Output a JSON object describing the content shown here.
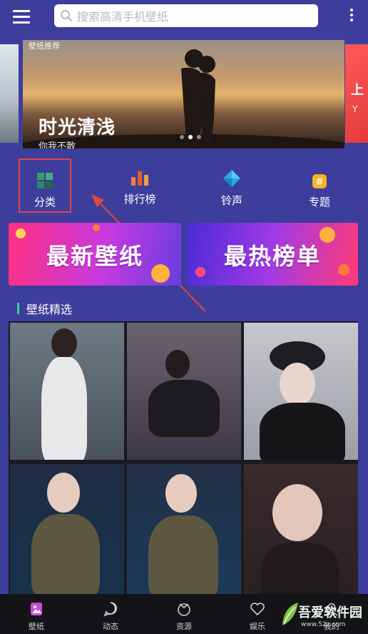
{
  "search": {
    "placeholder": "搜索高清手机壁纸"
  },
  "banner": {
    "tag": "壁纸推荐",
    "title": "时光清浅",
    "subtitle": "你我不散",
    "dots": 3,
    "active_dot": 1
  },
  "quick_links": [
    {
      "label": "分类",
      "icon": "category-grid-icon"
    },
    {
      "label": "排行榜",
      "icon": "ranking-bars-icon"
    },
    {
      "label": "铃声",
      "icon": "ringtone-diamond-icon"
    },
    {
      "label": "专题",
      "icon": "topic-hash-icon"
    }
  ],
  "promos": {
    "new": "最新壁纸",
    "hot": "最热榜单"
  },
  "section": {
    "title": "壁纸精选"
  },
  "tabs": [
    {
      "label": "壁纸",
      "icon": "wallpaper-icon"
    },
    {
      "label": "动态",
      "icon": "dynamic-icon"
    },
    {
      "label": "资源",
      "icon": "resource-icon"
    },
    {
      "label": "娱乐",
      "icon": "heart-icon"
    },
    {
      "label": "我的",
      "icon": "user-icon"
    }
  ],
  "watermark": {
    "text": "吾爱软件园",
    "url": "www.52z.com"
  },
  "colors": {
    "header": "#3d3d9c",
    "accent_highlight": "#e2453e",
    "section_bar": "#2bd4a0",
    "tabbar": "#131318"
  }
}
